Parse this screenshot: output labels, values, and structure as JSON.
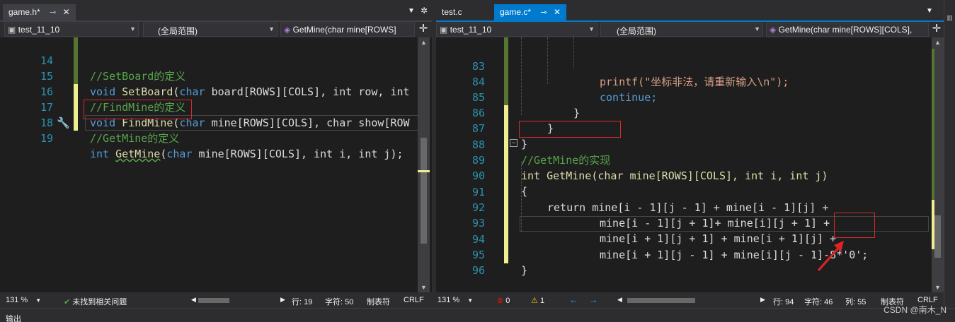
{
  "left": {
    "tab": {
      "label": "game.h*"
    },
    "nav": {
      "project": "test_11_10",
      "scope": "(全局范围)",
      "member": "GetMine(char mine[ROWS]"
    },
    "lines": [
      {
        "num": "14",
        "text": "//SetBoard的定义"
      },
      {
        "num": "15",
        "fn": "SetBoard",
        "params": "board[ROWS][COLS], int row, int"
      },
      {
        "num": "16",
        "text": "//FindMine的定义"
      },
      {
        "num": "17",
        "fn": "FindMine",
        "params": "mine[ROWS][COLS], char show[ROW"
      },
      {
        "num": "18",
        "text": "//GetMine的定义"
      },
      {
        "num": "19",
        "fn": "GetMine",
        "params": "mine[ROWS][COLS], int i, int j);"
      }
    ],
    "status": {
      "zoom": "131 %",
      "issues": "未找到相关问题",
      "row": "行: 19",
      "col": "字符: 50",
      "tab": "制表符",
      "eol": "CRLF"
    }
  },
  "right": {
    "tabs": [
      {
        "label": "test.c"
      },
      {
        "label": "game.c*"
      }
    ],
    "nav": {
      "project": "test_11_10",
      "scope": "(全局范围)",
      "member": "GetMine(char mine[ROWS][COLS],"
    },
    "lines": [
      {
        "num": "83",
        "text": "printf(\"坐标非法，请重新输入\\n\");"
      },
      {
        "num": "84",
        "text": "continue;"
      },
      {
        "num": "85",
        "text": "}"
      },
      {
        "num": "86",
        "text": "}"
      },
      {
        "num": "87",
        "text": "}"
      },
      {
        "num": "88",
        "text": "//GetMine的实现"
      },
      {
        "num": "89",
        "text": "int GetMine(char mine[ROWS][COLS], int i, int j)"
      },
      {
        "num": "90",
        "text": "{"
      },
      {
        "num": "91",
        "text": "return mine[i - 1][j - 1] + mine[i - 1][j] +"
      },
      {
        "num": "92",
        "text": "mine[i - 1][j + 1]+ mine[i][j + 1] +"
      },
      {
        "num": "93",
        "text": "mine[i + 1][j + 1] + mine[i + 1][j] +"
      },
      {
        "num": "94",
        "text": "mine[i + 1][j - 1] + mine[i][j - 1]-8*'0';"
      },
      {
        "num": "95",
        "text": "}"
      },
      {
        "num": "96",
        "text": ""
      }
    ],
    "status": {
      "zoom": "131 %",
      "errors": "0",
      "warnings": "1",
      "row": "行: 94",
      "col": "字符: 46",
      "colnum": "列: 55",
      "tab": "制表符",
      "eol": "CRLF"
    }
  },
  "footer": {
    "output_label": "输出",
    "watermark": "CSDN @南木_N"
  },
  "colors": {
    "accent": "#007acc",
    "highlight": "#d12b2b",
    "keyword": "#569cd6",
    "comment": "#57a64a",
    "function": "#dcdcaa",
    "linenum": "#2b91af"
  }
}
